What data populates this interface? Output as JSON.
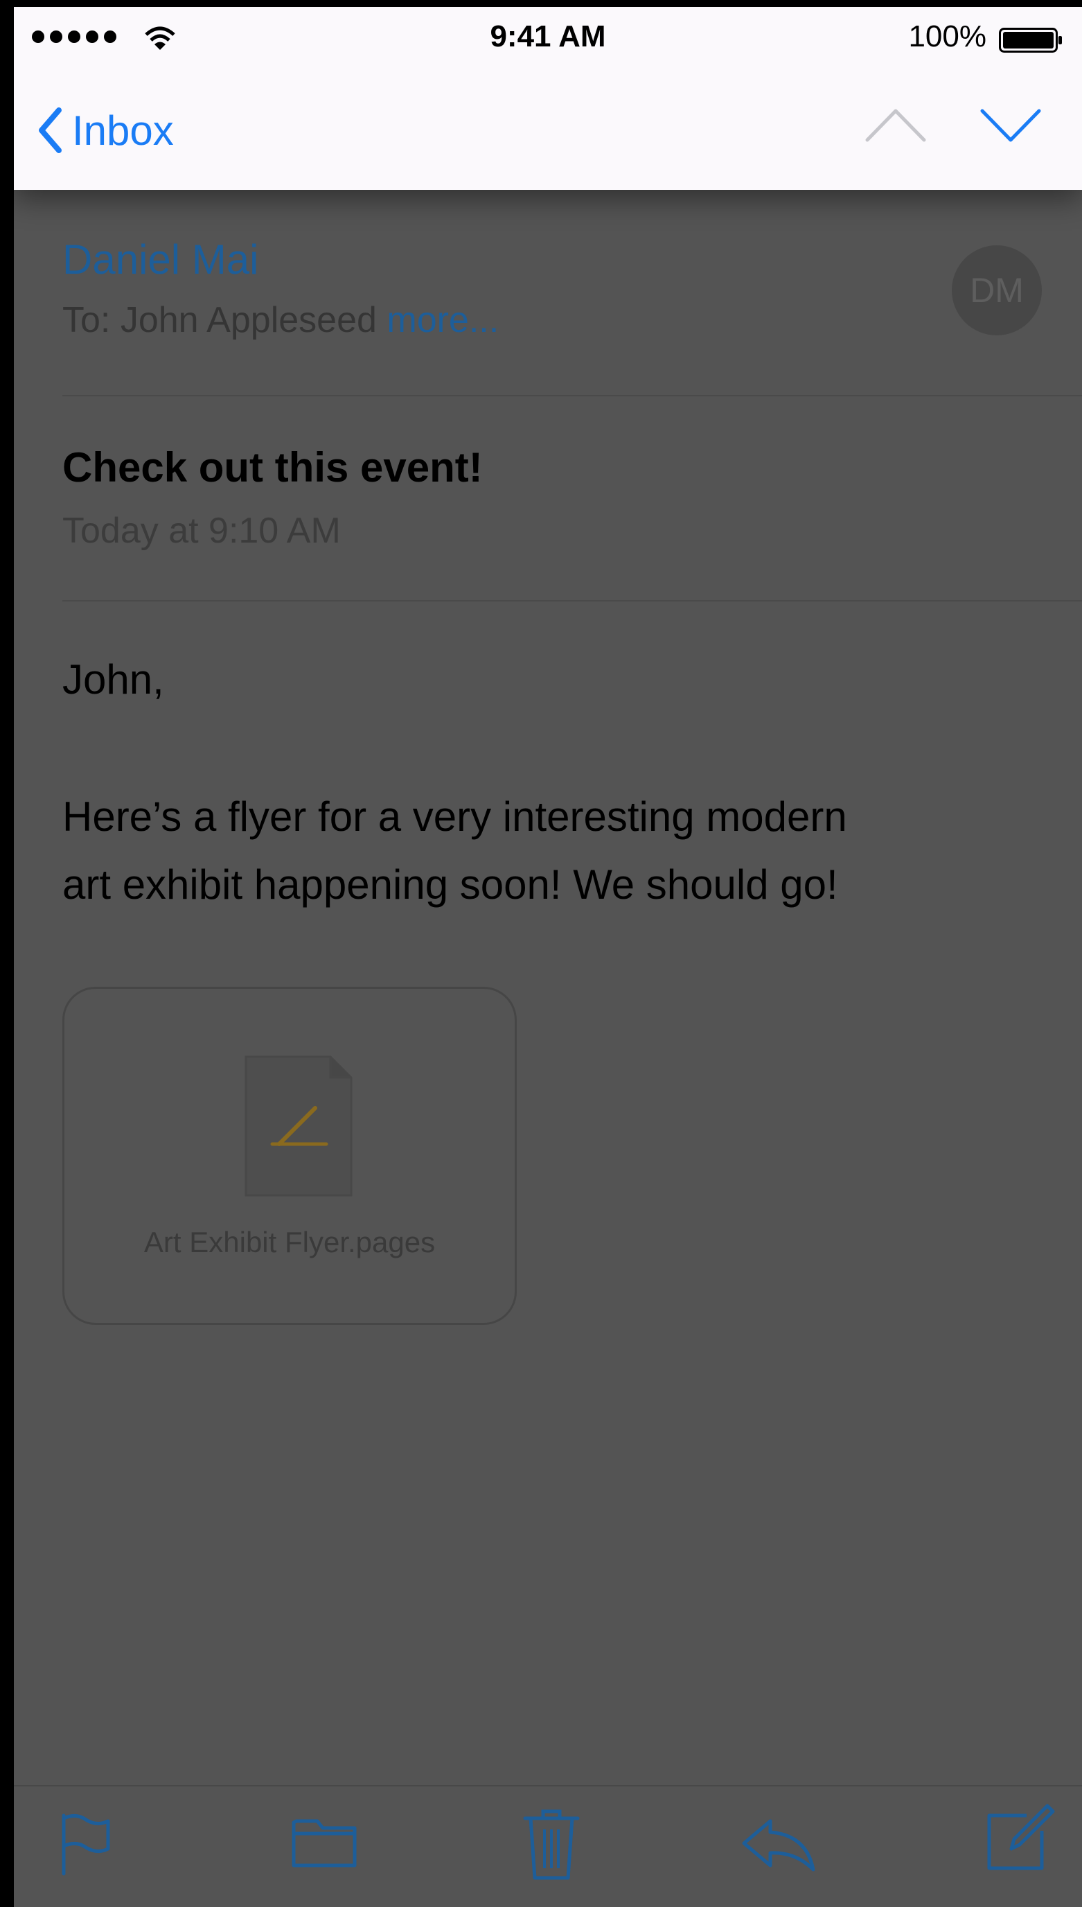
{
  "status_bar": {
    "time": "9:41 AM",
    "battery_percent": "100%",
    "signal_bars": 5,
    "icons": [
      "signal-dots-icon",
      "wifi-icon",
      "battery-icon"
    ]
  },
  "nav": {
    "back_label": "Inbox",
    "icons": [
      "chevron-left-icon",
      "chevron-up-icon",
      "chevron-down-icon"
    ],
    "accent_color": "#1a7cf5"
  },
  "message": {
    "sender": "Daniel Mai",
    "to_prefix": "To:",
    "recipient": "John Appleseed",
    "more_link": "more...",
    "avatar_initials": "DM",
    "subject": "Check out this event!",
    "date": "Today at 9:10 AM",
    "greeting": "John,",
    "body_line1": "Here’s a flyer for a very interesting modern",
    "body_line2": "art exhibit happening soon! We should go!",
    "attachment": {
      "name": "Art Exhibit Flyer.pages",
      "icon": "pages-document-icon"
    }
  },
  "toolbar": {
    "icons": [
      "flag-icon",
      "folder-icon",
      "trash-icon",
      "reply-icon",
      "compose-icon"
    ]
  }
}
